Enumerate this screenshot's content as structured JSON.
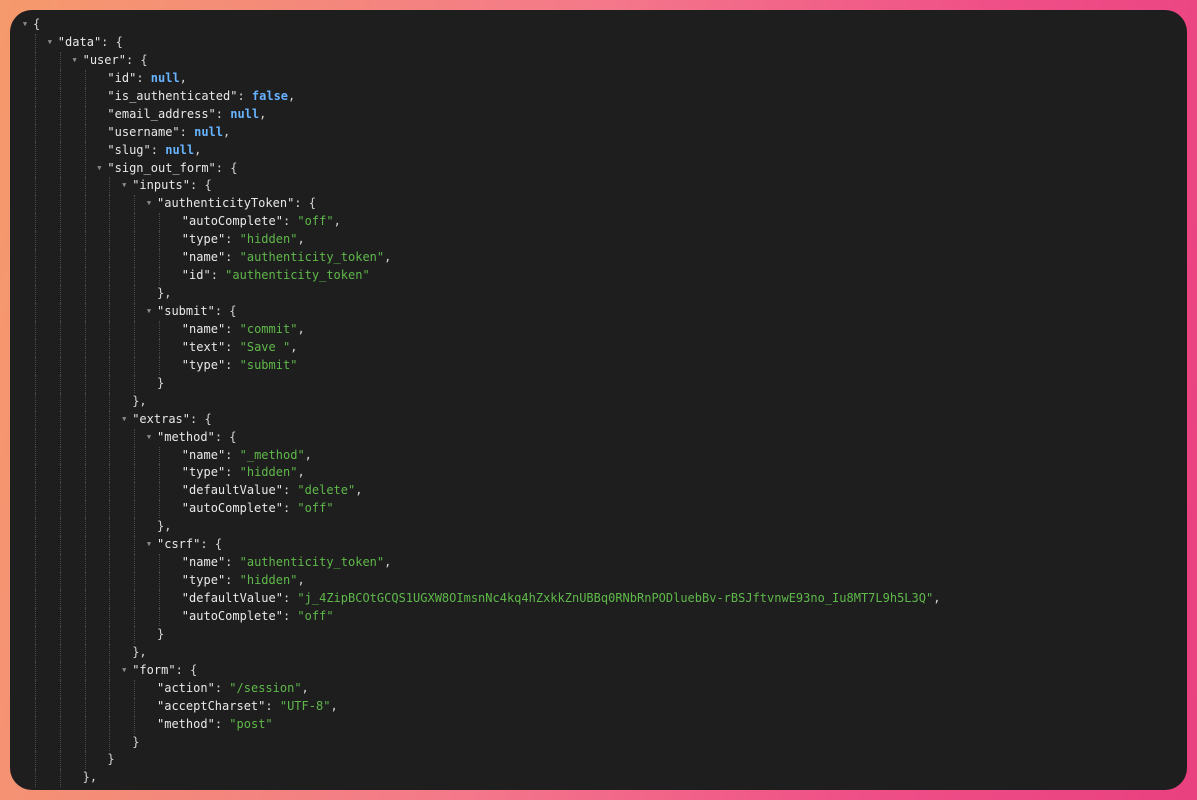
{
  "theme": {
    "background": "#1e1e1e",
    "key_color": "#e8e8e8",
    "string_color": "#5fb84a",
    "keyword_color": "#66b3ff",
    "punctuation_color": "#d4d4d4"
  },
  "icons": {
    "collapse": "triangle-down-icon"
  },
  "lines": [
    {
      "depth": 0,
      "toggle": true,
      "pre": "{"
    },
    {
      "depth": 1,
      "toggle": true,
      "key": "data",
      "pre": "{"
    },
    {
      "depth": 2,
      "toggle": true,
      "key": "user",
      "pre": "{"
    },
    {
      "depth": 3,
      "key": "id",
      "kw": "null",
      "post": ","
    },
    {
      "depth": 3,
      "key": "is_authenticated",
      "kw": "false",
      "post": ","
    },
    {
      "depth": 3,
      "key": "email_address",
      "kw": "null",
      "post": ","
    },
    {
      "depth": 3,
      "key": "username",
      "kw": "null",
      "post": ","
    },
    {
      "depth": 3,
      "key": "slug",
      "kw": "null",
      "post": ","
    },
    {
      "depth": 3,
      "toggle": true,
      "key": "sign_out_form",
      "pre": "{"
    },
    {
      "depth": 4,
      "toggle": true,
      "key": "inputs",
      "pre": "{"
    },
    {
      "depth": 5,
      "toggle": true,
      "key": "authenticityToken",
      "pre": "{"
    },
    {
      "depth": 6,
      "key": "autoComplete",
      "str": "off",
      "post": ","
    },
    {
      "depth": 6,
      "key": "type",
      "str": "hidden",
      "post": ","
    },
    {
      "depth": 6,
      "key": "name",
      "str": "authenticity_token",
      "post": ","
    },
    {
      "depth": 6,
      "key": "id",
      "str": "authenticity_token"
    },
    {
      "depth": 5,
      "pre": "},"
    },
    {
      "depth": 5,
      "toggle": true,
      "key": "submit",
      "pre": "{"
    },
    {
      "depth": 6,
      "key": "name",
      "str": "commit",
      "post": ","
    },
    {
      "depth": 6,
      "key": "text",
      "str": "Save ",
      "post": ","
    },
    {
      "depth": 6,
      "key": "type",
      "str": "submit"
    },
    {
      "depth": 5,
      "pre": "}"
    },
    {
      "depth": 4,
      "pre": "},"
    },
    {
      "depth": 4,
      "toggle": true,
      "key": "extras",
      "pre": "{"
    },
    {
      "depth": 5,
      "toggle": true,
      "key": "method",
      "pre": "{"
    },
    {
      "depth": 6,
      "key": "name",
      "str": "_method",
      "post": ","
    },
    {
      "depth": 6,
      "key": "type",
      "str": "hidden",
      "post": ","
    },
    {
      "depth": 6,
      "key": "defaultValue",
      "str": "delete",
      "post": ","
    },
    {
      "depth": 6,
      "key": "autoComplete",
      "str": "off"
    },
    {
      "depth": 5,
      "pre": "},"
    },
    {
      "depth": 5,
      "toggle": true,
      "key": "csrf",
      "pre": "{"
    },
    {
      "depth": 6,
      "key": "name",
      "str": "authenticity_token",
      "post": ","
    },
    {
      "depth": 6,
      "key": "type",
      "str": "hidden",
      "post": ","
    },
    {
      "depth": 6,
      "key": "defaultValue",
      "str": "j_4ZipBCOtGCQS1UGXW8OImsnNc4kq4hZxkkZnUBBq0RNbRnPODluebBv-rBSJftvnwE93no_Iu8MT7L9h5L3Q",
      "post": ","
    },
    {
      "depth": 6,
      "key": "autoComplete",
      "str": "off"
    },
    {
      "depth": 5,
      "pre": "}"
    },
    {
      "depth": 4,
      "pre": "},"
    },
    {
      "depth": 4,
      "toggle": true,
      "key": "form",
      "pre": "{"
    },
    {
      "depth": 5,
      "key": "action",
      "str": "/session",
      "post": ","
    },
    {
      "depth": 5,
      "key": "acceptCharset",
      "str": "UTF-8",
      "post": ","
    },
    {
      "depth": 5,
      "key": "method",
      "str": "post"
    },
    {
      "depth": 4,
      "pre": "}"
    },
    {
      "depth": 3,
      "pre": "}"
    },
    {
      "depth": 2,
      "pre": "},"
    }
  ]
}
